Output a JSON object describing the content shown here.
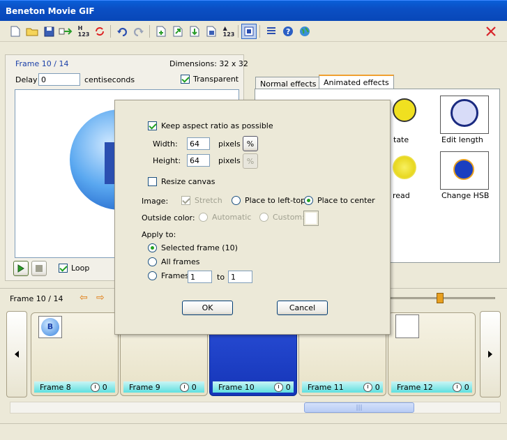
{
  "window": {
    "title": "Beneton Movie GIF"
  },
  "toolbar": {
    "icons": [
      "new-icon",
      "open-icon",
      "save-icon",
      "export-icon",
      "numbering-icon",
      "refresh-icon",
      "undo-icon",
      "redo-icon",
      "add-frame-icon",
      "import-frame-icon",
      "export-frame-icon",
      "save-frame-icon",
      "number-frames-icon",
      "fit-icon",
      "list-icon",
      "help-icon",
      "web-icon",
      "close-icon"
    ]
  },
  "frame_panel": {
    "frame_label": "Frame 10 / 14",
    "dimensions": "Dimensions: 32 x 32",
    "delay_label": "Delay",
    "delay_value": "0",
    "delay_unit": "centiseconds",
    "transparent_label": "Transparent",
    "transparent_checked": true,
    "loop_label": "Loop",
    "loop_checked": true
  },
  "effects": {
    "tabs": [
      "Normal effects",
      "Animated effects"
    ],
    "active_tab": "Animated effects",
    "items": [
      "tate",
      "Edit length",
      "read",
      "Change HSB"
    ]
  },
  "navbar": {
    "frame_label": "Frame 10 / 14"
  },
  "frames": [
    {
      "label": "Frame 8",
      "delay": "0"
    },
    {
      "label": "Frame 9",
      "delay": "0"
    },
    {
      "label": "Frame 10",
      "delay": "0"
    },
    {
      "label": "Frame 11",
      "delay": "0"
    },
    {
      "label": "Frame 12",
      "delay": "0"
    }
  ],
  "dialog": {
    "keep_aspect_label": "Keep aspect ratio as possible",
    "keep_aspect_checked": true,
    "width_label": "Width:",
    "width_value": "64",
    "height_label": "Height:",
    "height_value": "64",
    "pixels_label": "pixels",
    "percent_label": "%",
    "resize_canvas_label": "Resize canvas",
    "image_label": "Image:",
    "stretch_label": "Stretch",
    "place_left_top_label": "Place to left-top",
    "place_center_label": "Place to center",
    "outside_color_label": "Outside color:",
    "automatic_label": "Automatic",
    "custom_label": "Custom:",
    "apply_to_label": "Apply to:",
    "selected_frame_label": "Selected frame (10)",
    "all_frames_label": "All frames",
    "frames_label": "Frames",
    "frames_from": "1",
    "to_label": "to",
    "frames_to": "1",
    "ok_label": "OK",
    "cancel_label": "Cancel"
  }
}
